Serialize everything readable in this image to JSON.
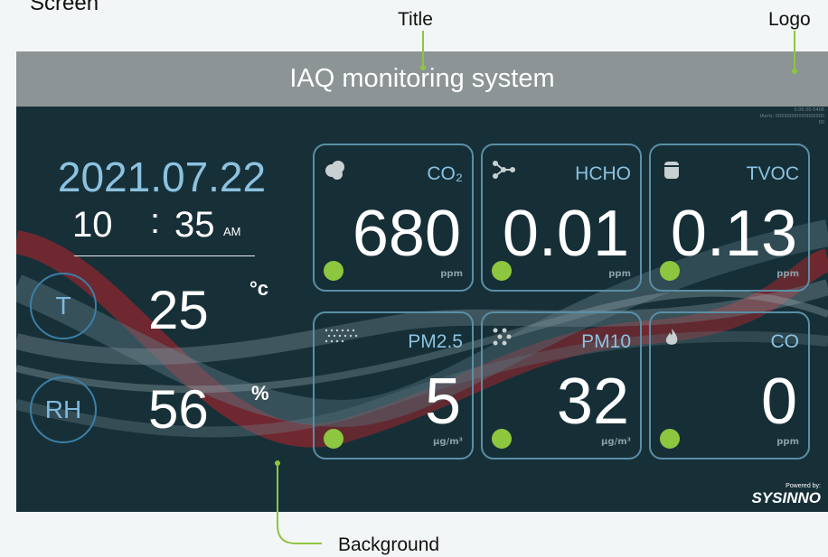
{
  "annotations": {
    "screen": "Screen",
    "title": "Title",
    "logo": "Logo",
    "background": "Background"
  },
  "header": {
    "title": "IAQ monitoring system"
  },
  "meta_lines": [
    "0.00.00-5406",
    "IAeris: 00000000000000000",
    "00"
  ],
  "clock": {
    "date": "2021.07.22",
    "hour": "10",
    "sep": ":",
    "minute": "35",
    "ampm": "AM"
  },
  "climate": {
    "temperature": {
      "label": "T",
      "value": "25",
      "unit": "°c"
    },
    "humidity": {
      "label": "RH",
      "value": "56",
      "unit": "%"
    }
  },
  "cards": [
    {
      "name": "CO₂",
      "value": "680",
      "unit": "ppm",
      "icon": "cloud-icon",
      "status_color": "#8dc63f"
    },
    {
      "name": "HCHO",
      "value": "0.01",
      "unit": "ppm",
      "icon": "molecule-icon",
      "status_color": "#8dc63f"
    },
    {
      "name": "TVOC",
      "value": "0.13",
      "unit": "ppm",
      "icon": "canister-icon",
      "status_color": "#8dc63f"
    },
    {
      "name": "PM2.5",
      "value": "5",
      "unit": "µg/m³",
      "icon": "fine-dust-icon",
      "status_color": "#8dc63f"
    },
    {
      "name": "PM10",
      "value": "32",
      "unit": "µg/m³",
      "icon": "coarse-dust-icon",
      "status_color": "#8dc63f"
    },
    {
      "name": "CO",
      "value": "0",
      "unit": "ppm",
      "icon": "flame-icon",
      "status_color": "#8dc63f"
    }
  ],
  "branding": {
    "powered_by": "Powered by:",
    "name": "SYSINNO"
  },
  "colors": {
    "accent": "#8cc2e0",
    "status_good": "#8dc63f",
    "panel_bg": "#173038",
    "titlebar": "#8c9496"
  }
}
